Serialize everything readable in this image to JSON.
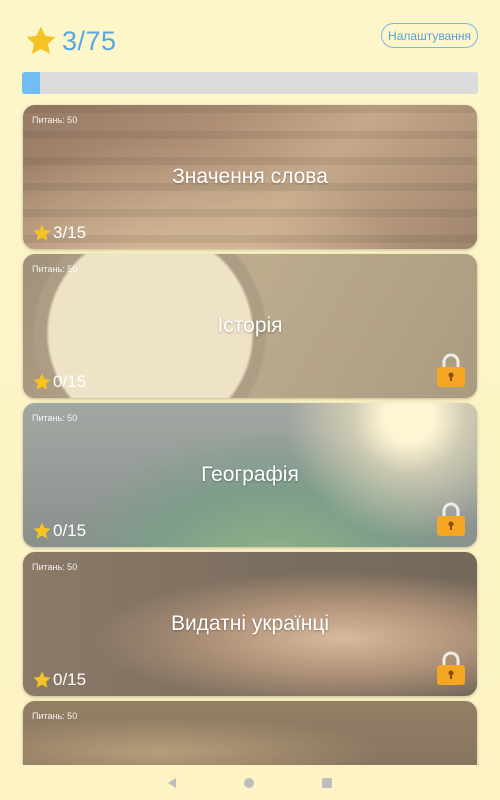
{
  "header": {
    "total_score": "3/75",
    "settings_label": "Налаштування"
  },
  "progress": {
    "fraction": 0.04
  },
  "categories": [
    {
      "questions_label": "Питань: 50",
      "title": "Значення слова",
      "score": "3/15",
      "locked": false
    },
    {
      "questions_label": "Питань: 50",
      "title": "Історія",
      "score": "0/15",
      "locked": true
    },
    {
      "questions_label": "Питань: 50",
      "title": "Географія",
      "score": "0/15",
      "locked": true
    },
    {
      "questions_label": "Питань: 50",
      "title": "Видатні українці",
      "score": "0/15",
      "locked": true
    },
    {
      "questions_label": "Питань: 50"
    }
  ],
  "icons": {
    "star": "star-icon",
    "lock": "lock-icon"
  },
  "colors": {
    "accent": "#55a8e8",
    "star": "#f6c324",
    "lock": "#f5a623"
  }
}
